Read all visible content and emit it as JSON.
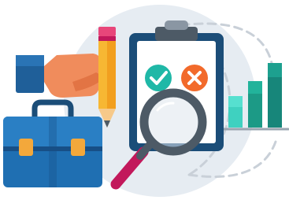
{
  "illustration": {
    "icons": [
      "background-circle-icon",
      "dashed-arc-icon",
      "hand-icon",
      "pencil-icon",
      "briefcase-icon",
      "clipboard-icon",
      "check-circle-icon",
      "cross-circle-icon",
      "magnifying-glass-icon",
      "bar-chart-icon"
    ],
    "colors": {
      "background_circle": "#e6ecf2",
      "dashed_arc": "#c9d0d8",
      "hand": "#f08c5c",
      "sleeve": "#1f5f99",
      "pencil_body": "#f7b733",
      "pencil_eraser": "#e8467a",
      "briefcase": "#1f6fb2",
      "briefcase_dark": "#174f86",
      "clasp": "#f3a83b",
      "clipboard_frame": "#1b4d78",
      "clipboard_paper": "#ffffff",
      "check": "#1fb8a7",
      "cross": "#f26a2b",
      "magnifier_ring": "#4d5a66",
      "magnifier_handle": "#c2185b",
      "bars": [
        "#3fd1c0",
        "#1c9a86",
        "#17867a"
      ],
      "axis": "#9aa5b0"
    }
  }
}
